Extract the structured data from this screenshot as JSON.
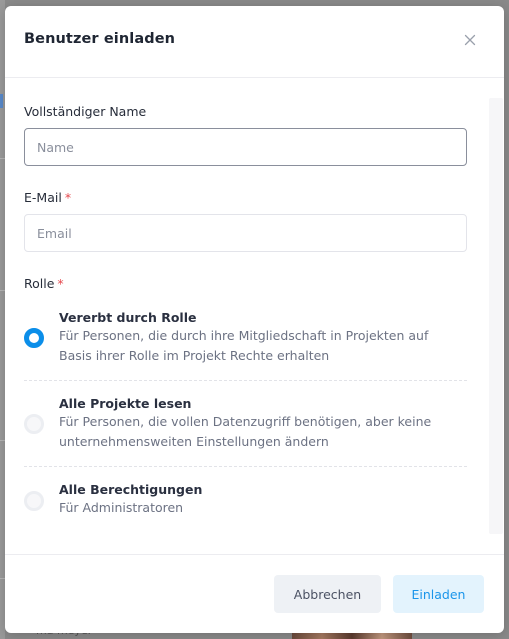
{
  "modal": {
    "title": "Benutzer einladen",
    "close_icon": "close-icon"
  },
  "form": {
    "name": {
      "label": "Vollständiger Name",
      "placeholder": "Name",
      "value": ""
    },
    "email": {
      "label": "E-Mail",
      "required_marker": "*",
      "placeholder": "Email",
      "value": ""
    },
    "role": {
      "label": "Rolle",
      "required_marker": "*",
      "selected": "inherited",
      "options": [
        {
          "id": "inherited",
          "title": "Vererbt durch Rolle",
          "description": "Für Personen, die durch ihre Mitgliedschaft in Projekten auf Basis ihrer Rolle im Projekt Rechte erhalten"
        },
        {
          "id": "read_all",
          "title": "Alle Projekte lesen",
          "description": "Für Personen, die vollen Datenzugriff benötigen, aber keine unternehmensweiten Einstellungen ändern"
        },
        {
          "id": "all_permissions",
          "title": "Alle Berechtigungen",
          "description": "Für Administratoren"
        }
      ]
    }
  },
  "footer": {
    "cancel_label": "Abbrechen",
    "invite_label": "Einladen"
  },
  "background": {
    "peek_text": "ma meyer"
  },
  "colors": {
    "accent": "#0b8ee9",
    "required": "#e5484d",
    "invite_bg": "#e3f3fd",
    "cancel_bg": "#eef1f5"
  }
}
